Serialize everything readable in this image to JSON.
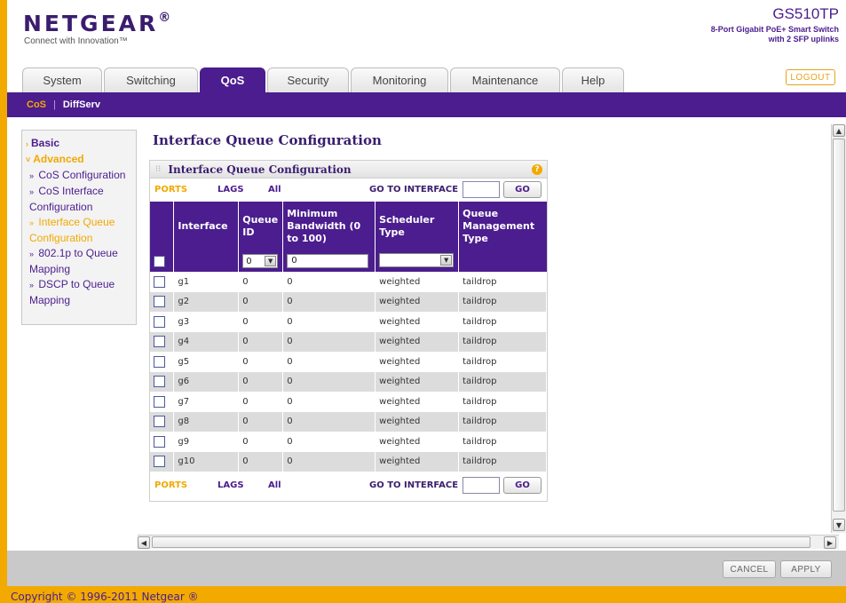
{
  "brand": {
    "logo": "NETGEAR",
    "tagline": "Connect with Innovation™",
    "model": "GS510TP",
    "model_desc_1": "8-Port Gigabit PoE+ Smart Switch",
    "model_desc_2": "with 2 SFP uplinks"
  },
  "tabs": [
    {
      "label": "System",
      "active": false
    },
    {
      "label": "Switching",
      "active": false
    },
    {
      "label": "QoS",
      "active": true
    },
    {
      "label": "Security",
      "active": false
    },
    {
      "label": "Monitoring",
      "active": false
    },
    {
      "label": "Maintenance",
      "active": false
    },
    {
      "label": "Help",
      "active": false
    }
  ],
  "logout_label": "LOGOUT",
  "subnav": {
    "cos": "CoS",
    "sep": "|",
    "diffserv": "DiffServ"
  },
  "sidebar": {
    "basic": "Basic",
    "advanced": "Advanced",
    "items": [
      {
        "label": "CoS Configuration"
      },
      {
        "label": "CoS Interface Configuration"
      },
      {
        "label": "Interface Queue Configuration"
      },
      {
        "label": "802.1p to Queue Mapping"
      },
      {
        "label": "DSCP to Queue Mapping"
      }
    ]
  },
  "page_title": "Interface Queue Configuration",
  "panel": {
    "title": "Interface Queue Configuration",
    "help": "?",
    "nav": {
      "ports": "PORTS",
      "lags": "LAGS",
      "all": "All",
      "goto": "GO TO INTERFACE",
      "go": "GO"
    },
    "columns": [
      "Interface",
      "Queue ID",
      "Minimum Bandwidth (0 to 100)",
      "Scheduler Type",
      "Queue Management Type"
    ],
    "filter": {
      "queue_id": "0",
      "min_bw": "0",
      "scheduler": ""
    },
    "rows": [
      {
        "interface": "g1",
        "queue_id": "0",
        "min_bw": "0",
        "scheduler": "weighted",
        "mgmt": "taildrop"
      },
      {
        "interface": "g2",
        "queue_id": "0",
        "min_bw": "0",
        "scheduler": "weighted",
        "mgmt": "taildrop"
      },
      {
        "interface": "g3",
        "queue_id": "0",
        "min_bw": "0",
        "scheduler": "weighted",
        "mgmt": "taildrop"
      },
      {
        "interface": "g4",
        "queue_id": "0",
        "min_bw": "0",
        "scheduler": "weighted",
        "mgmt": "taildrop"
      },
      {
        "interface": "g5",
        "queue_id": "0",
        "min_bw": "0",
        "scheduler": "weighted",
        "mgmt": "taildrop"
      },
      {
        "interface": "g6",
        "queue_id": "0",
        "min_bw": "0",
        "scheduler": "weighted",
        "mgmt": "taildrop"
      },
      {
        "interface": "g7",
        "queue_id": "0",
        "min_bw": "0",
        "scheduler": "weighted",
        "mgmt": "taildrop"
      },
      {
        "interface": "g8",
        "queue_id": "0",
        "min_bw": "0",
        "scheduler": "weighted",
        "mgmt": "taildrop"
      },
      {
        "interface": "g9",
        "queue_id": "0",
        "min_bw": "0",
        "scheduler": "weighted",
        "mgmt": "taildrop"
      },
      {
        "interface": "g10",
        "queue_id": "0",
        "min_bw": "0",
        "scheduler": "weighted",
        "mgmt": "taildrop"
      }
    ]
  },
  "footer": {
    "cancel": "CANCEL",
    "apply": "APPLY",
    "copyright": "Copyright © 1996-2011 Netgear ®"
  },
  "colors": {
    "purple": "#4b1d8e",
    "orange": "#f2a900"
  },
  "icons": {
    "scroll_up": "scroll-up-arrow-icon",
    "scroll_down": "scroll-down-arrow-icon",
    "scroll_left": "scroll-left-arrow-icon",
    "scroll_right": "scroll-right-arrow-icon",
    "help": "help-icon",
    "dropdown": "chevron-down-icon"
  }
}
